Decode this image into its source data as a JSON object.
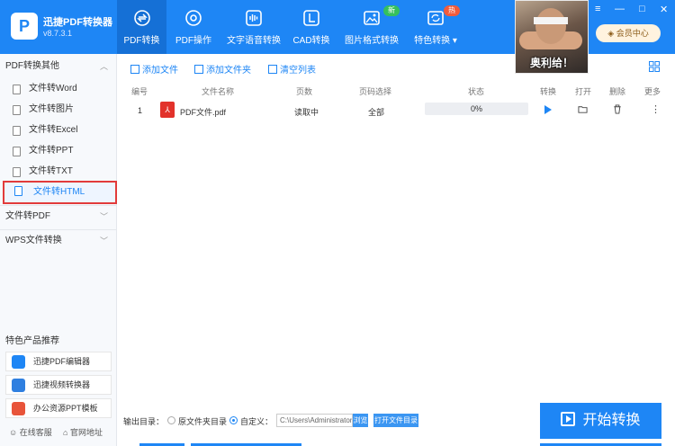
{
  "app": {
    "name": "迅捷PDF转换器",
    "version": "v8.7.3.1",
    "logo": "P"
  },
  "nav": [
    {
      "label": "PDF转换",
      "icon": "pdf-convert-icon",
      "active": true
    },
    {
      "label": "PDF操作",
      "icon": "pdf-operate-icon"
    },
    {
      "label": "文字语音转换",
      "icon": "voice-icon"
    },
    {
      "label": "CAD转换",
      "icon": "cad-icon"
    },
    {
      "label": "图片格式转换",
      "icon": "image-icon",
      "badge": "新"
    },
    {
      "label": "特色转换",
      "icon": "special-icon",
      "badge": "热",
      "dropdown": "▾"
    }
  ],
  "window": {
    "menu": "≡",
    "minimize": "—",
    "maximize": "□",
    "close": "✕"
  },
  "member_label": "会员中心",
  "meme_caption": "奥利给！",
  "sidebar": {
    "group_pdf_other": "PDF转换其他",
    "items": [
      "文件转Word",
      "文件转图片",
      "文件转Excel",
      "文件转PPT",
      "文件转TXT",
      "文件转HTML"
    ],
    "group_to_pdf": "文件转PDF",
    "group_wps": "WPS文件转换",
    "chevron_up": "︿",
    "chevron_down": "﹀",
    "promo_title": "特色产品推荐",
    "promos": [
      "迅捷PDF编辑器",
      "迅捷视频转换器",
      "办公资源PPT模板"
    ],
    "footer": {
      "service": "在线客服",
      "website": "官网地址"
    }
  },
  "toolbar": {
    "add_file": "添加文件",
    "add_folder": "添加文件夹",
    "clear": "清空列表"
  },
  "table": {
    "headers": {
      "index": "编号",
      "name": "文件名称",
      "pages": "页数",
      "page_select": "页码选择",
      "status": "状态",
      "convert": "转换",
      "open": "打开",
      "delete": "删除",
      "more": "更多"
    },
    "rows": [
      {
        "index": "1",
        "name": "PDF文件.pdf",
        "pages": "读取中",
        "page_select": "全部",
        "progress": 0,
        "progress_text": "0%"
      }
    ]
  },
  "output": {
    "label": "输出目录：",
    "option_source": "原文件夹目录",
    "option_custom": "自定义：",
    "path": "C:\\Users\\Administrator",
    "browse": "浏览",
    "open_folder": "打开文件目录",
    "selected": "custom"
  },
  "start_button": "开始转换",
  "colors": {
    "primary": "#1e86f5",
    "highlight_border": "#e23b3b"
  }
}
